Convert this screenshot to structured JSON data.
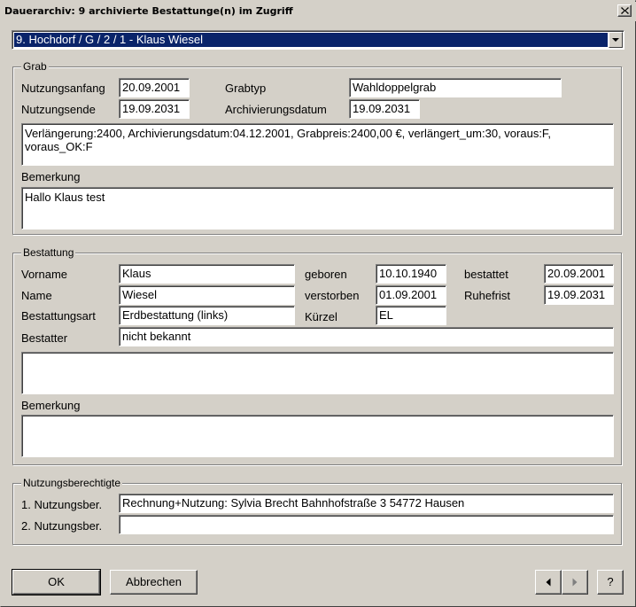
{
  "window": {
    "title": "Dauerarchiv:  9 archivierte Bestattunge(n) im Zugriff"
  },
  "selector": {
    "value": "9. Hochdorf / G / 2 / 1  -  Klaus Wiesel"
  },
  "grab": {
    "label": "Grab",
    "nutzungsanfang_label": "Nutzungsanfang",
    "nutzungsanfang": "20.09.2001",
    "nutzungsende_label": "Nutzungsende",
    "nutzungsende": "19.09.2031",
    "grabtyp_label": "Grabtyp",
    "grabtyp": "Wahldoppelgrab",
    "archivierungsdatum_label": "Archivierungsdatum",
    "archivierungsdatum": "19.09.2031",
    "info": "Verlängerung:2400, Archivierungsdatum:04.12.2001, Grabpreis:2400,00 €, verlängert_um:30, voraus:F, voraus_OK:F",
    "bemerkung_label": "Bemerkung",
    "bemerkung": "Hallo Klaus test"
  },
  "bestattung": {
    "label": "Bestattung",
    "vorname_label": "Vorname",
    "vorname": "Klaus",
    "name_label": "Name",
    "name": "Wiesel",
    "bestattungsart_label": "Bestattungsart",
    "bestattungsart": "Erdbestattung (links)",
    "bestatter_label": "Bestatter",
    "bestatter": "nicht bekannt",
    "geboren_label": "geboren",
    "geboren": "10.10.1940",
    "verstorben_label": "verstorben",
    "verstorben": "01.09.2001",
    "kuerzel_label": "Kürzel",
    "kuerzel": "EL",
    "bestattet_label": "bestattet",
    "bestattet": "20.09.2001",
    "ruhefrist_label": "Ruhefrist",
    "ruhefrist": "19.09.2031",
    "notes": "",
    "bemerkung_label": "Bemerkung",
    "bemerkung": ""
  },
  "nutzungsberechtigte": {
    "label": "Nutzungsberechtigte",
    "ber1_label": "1. Nutzungsber.",
    "ber1": "Rechnung+Nutzung: Sylvia Brecht Bahnhofstraße 3 54772 Hausen",
    "ber2_label": "2. Nutzungsber.",
    "ber2": ""
  },
  "buttons": {
    "ok": "OK",
    "cancel": "Abbrechen",
    "help": "?"
  },
  "icons": {
    "close": "close-icon",
    "dropdown": "chevron-down-icon",
    "prev": "chevron-left-icon",
    "next": "chevron-right-icon"
  }
}
